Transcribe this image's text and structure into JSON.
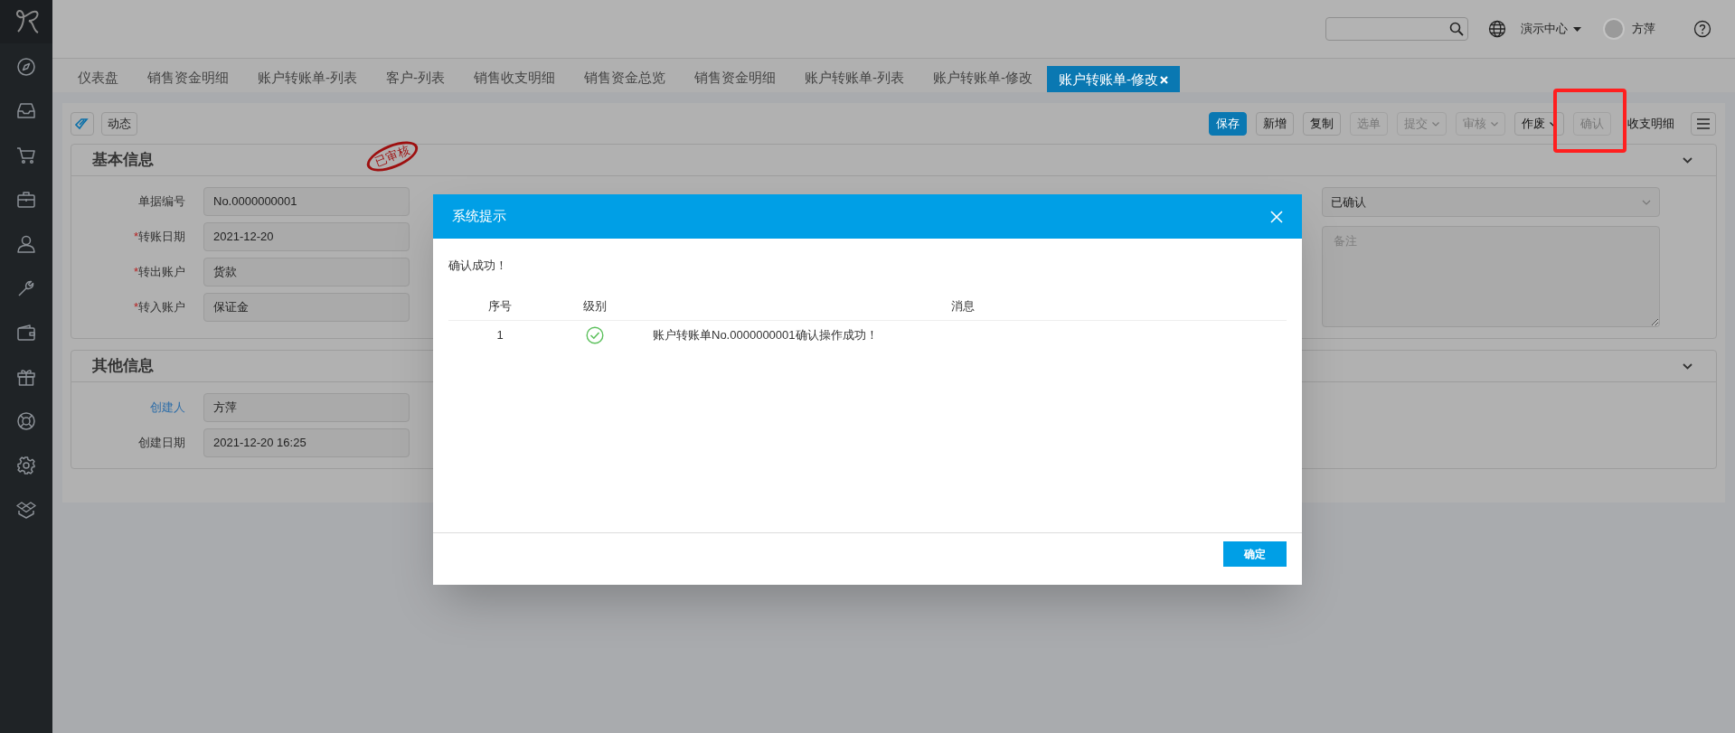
{
  "topbar": {
    "org": "演示中心",
    "user": "方萍"
  },
  "tabs": [
    {
      "label": "仪表盘",
      "selected": false,
      "closable": false
    },
    {
      "label": "销售资金明细",
      "selected": false,
      "closable": false
    },
    {
      "label": "账户转账单-列表",
      "selected": false,
      "closable": false
    },
    {
      "label": "客户-列表",
      "selected": false,
      "closable": false
    },
    {
      "label": "销售收支明细",
      "selected": false,
      "closable": false
    },
    {
      "label": "销售资金总览",
      "selected": false,
      "closable": false
    },
    {
      "label": "销售资金明细",
      "selected": false,
      "closable": false
    },
    {
      "label": "账户转账单-列表",
      "selected": false,
      "closable": false
    },
    {
      "label": "账户转账单-修改",
      "selected": false,
      "closable": false
    },
    {
      "label": "账户转账单-修改",
      "selected": true,
      "closable": true
    }
  ],
  "toolbar": {
    "left_button": "动态",
    "buttons": [
      {
        "label": "保存",
        "kind": "primary",
        "dropdown": false,
        "highlighted": false
      },
      {
        "label": "新增",
        "kind": "default",
        "dropdown": false,
        "highlighted": false
      },
      {
        "label": "复制",
        "kind": "default",
        "dropdown": false,
        "highlighted": false
      },
      {
        "label": "选单",
        "kind": "disabled",
        "dropdown": false,
        "highlighted": false
      },
      {
        "label": "提交",
        "kind": "disabled",
        "dropdown": true,
        "highlighted": false
      },
      {
        "label": "审核",
        "kind": "disabled",
        "dropdown": true,
        "highlighted": false
      },
      {
        "label": "作废",
        "kind": "default",
        "dropdown": true,
        "highlighted": false
      },
      {
        "label": "确认",
        "kind": "disabled",
        "dropdown": false,
        "highlighted": true
      },
      {
        "label": "收支明细",
        "kind": "plain",
        "dropdown": false,
        "highlighted": false
      }
    ]
  },
  "stamp": "已审核",
  "sections": [
    {
      "title": "基本信息",
      "fields": [
        {
          "label": "单据编号",
          "value": "No.0000000001",
          "link": false
        },
        {
          "required_mark": "*",
          "label": "转账日期",
          "value": "2021-12-20",
          "link": false
        },
        {
          "required_mark": "*",
          "label": "转出账户",
          "value": "货款",
          "link": false
        },
        {
          "required_mark": "*",
          "label": "转入账户",
          "value": "保证金",
          "link": false
        }
      ],
      "status_select": "已确认",
      "remarks": {
        "placeholder": "备注"
      }
    },
    {
      "title": "其他信息",
      "fields": [
        {
          "label": "创建人",
          "value": "方萍",
          "link": true
        },
        {
          "label": "创建日期",
          "value": "2021-12-20 16:25",
          "link": false
        }
      ]
    }
  ],
  "dialog": {
    "title": "系统提示",
    "message": "确认成功！",
    "columns": [
      "序号",
      "级别",
      "消息"
    ],
    "rows": [
      {
        "index": "1",
        "kind": "success",
        "message": "账户转账单No.0000000001确认操作成功！"
      }
    ],
    "ok_button": "确定"
  }
}
